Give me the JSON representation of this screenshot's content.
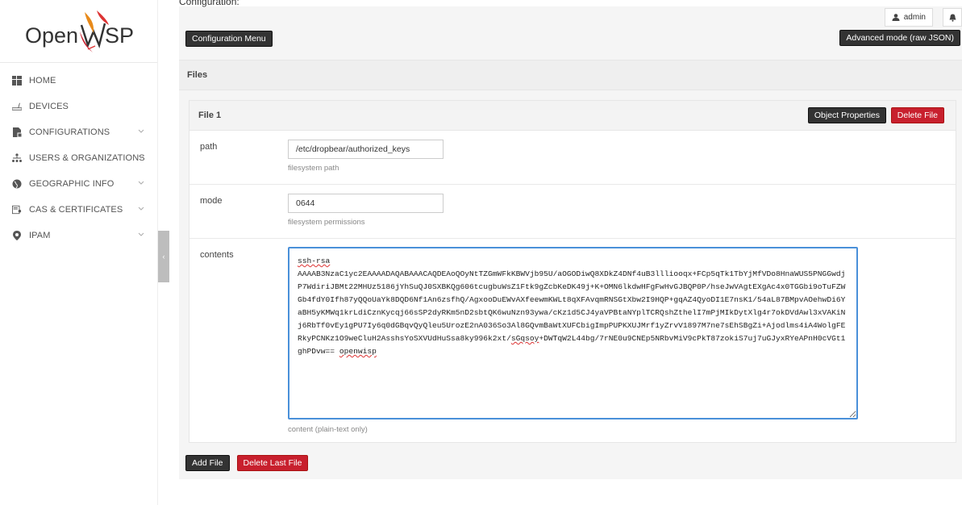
{
  "brand": {
    "logo_text_left": "Open",
    "logo_text_right": "SP"
  },
  "sidebar": {
    "items": [
      {
        "label": "HOME",
        "icon": "home-icon",
        "has_chevron": false
      },
      {
        "label": "DEVICES",
        "icon": "router-icon",
        "has_chevron": false
      },
      {
        "label": "CONFIGURATIONS",
        "icon": "file-icon",
        "has_chevron": true
      },
      {
        "label": "USERS & ORGANIZATIONS",
        "icon": "org-icon",
        "has_chevron": true
      },
      {
        "label": "GEOGRAPHIC INFO",
        "icon": "globe-icon",
        "has_chevron": true
      },
      {
        "label": "CAS & CERTIFICATES",
        "icon": "certificate-icon",
        "has_chevron": true
      },
      {
        "label": "IPAM",
        "icon": "location-pin-icon",
        "has_chevron": true
      }
    ],
    "collapse_glyph": "‹"
  },
  "header": {
    "section_title": "Configuration:",
    "user_label": "admin"
  },
  "toolbar": {
    "config_menu_label": "Configuration Menu",
    "advanced_mode_label": "Advanced mode (raw JSON)"
  },
  "files": {
    "section_label": "Files",
    "file": {
      "title": "File 1",
      "object_properties_label": "Object Properties",
      "delete_file_label": "Delete File",
      "path": {
        "label": "path",
        "value": "/etc/dropbear/authorized_keys",
        "help": "filesystem path"
      },
      "mode": {
        "label": "mode",
        "value": "0644",
        "help": "filesystem permissions"
      },
      "contents": {
        "label": "contents",
        "line1": "ssh-rsa",
        "body": "AAAAB3NzaC1yc2EAAAADAQABAAACAQDEAoQOyNtTZGmWFkKBWVjb95U/aOGODiwQ8XDkZ4DNf4uB3llliooqx+FCp5qTk1TbYjMfVDo8HnaWUS5PNGGwdjP7WdiriJBMt22MHUz5186jYhSuQJ0SXBKQg606tcugbuWsZ1Ftk9gZcbKeDK49j+K+OMN6lkdwHFgFwHvGJBQP0P/hseJwVAgtEXgAc4x0TGGbi9oTuFZWGb4fdY0Ifh87yQQoUaYk8DQD6Nf1An6zsfhQ/AgxooDuEWvAXfeewmKWLt8qXFAvqmRNSGtXbw2I9HQP+gqAZ4QyoDI1E7nsK1/54aL87BMpvAOehwDi6YaBH5yKMWq1krLdiCznKycqj66sSP2dyRKm5nD2sbtQK6wuNzn93ywa/cKz1d5CJ4yaVPBtaNYplTCRQshZthelI7mPjMIkDytXlg4r7okDVdAwl3xVAKiNj6RbTf0vEy1gPU7Iy6q0dGBqvQyQleu5UrozE2nA036So3Al8GQvmBaWtXUFCbigImpPUPKXUJMrf1yZrvV1897M7ne7sEhSBgZi+Ajodlms4iA4WolgFERkyPCNKz1O9weCluH2AsshsYoSXVUdHuSsa8ky996k2xt/",
        "tail_start": "sGqsoy",
        "tail_mid": "+DWTqW2L44bg/7rNE0u9CNEp5NRbvMiV9cPkT87zokiS7uj7uGJyxRYeAPnH0cVGt1ghPDvw== ",
        "tail_end": "openwisp",
        "help": "content (plain-text only)"
      }
    },
    "add_file_label": "Add File",
    "delete_last_label": "Delete Last File"
  },
  "colors": {
    "accent_red": "#c8202e",
    "dark_button": "#333333",
    "focus_blue": "#4a90d9"
  }
}
